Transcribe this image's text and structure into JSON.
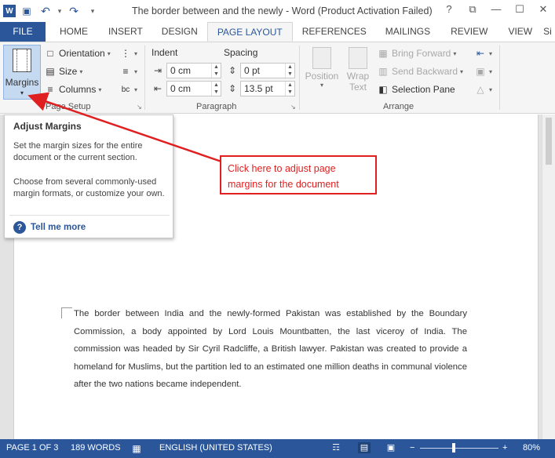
{
  "window": {
    "title": "The border between and the newly - Word (Product Activation Failed)",
    "controls": {
      "help": "?",
      "ribbon_display": "⧉",
      "minimize": "—",
      "maximize": "☐",
      "close": "✕"
    }
  },
  "qat": {
    "logo": "W",
    "save_icon": "💾",
    "undo_icon": "↶",
    "undo_caret": "▾",
    "redo_icon": "↷",
    "customize_icon": "▾"
  },
  "tabs": [
    "FILE",
    "HOME",
    "INSERT",
    "DESIGN",
    "PAGE LAYOUT",
    "REFERENCES",
    "MAILINGS",
    "REVIEW",
    "VIEW",
    "Si"
  ],
  "ribbon": {
    "page_setup": {
      "label": "Page Setup",
      "margins": "Margins",
      "orientation": "Orientation",
      "size": "Size",
      "columns": "Columns",
      "breaks_icon": "⋮",
      "line_numbers_icon": "≡",
      "hyphenation_icon": "bc"
    },
    "paragraph": {
      "label": "Paragraph",
      "indent_header": "Indent",
      "spacing_header": "Spacing",
      "indent_left": "0 cm",
      "indent_right": "0 cm",
      "spacing_before": "0 pt",
      "spacing_after": "13.5 pt"
    },
    "arrange": {
      "label": "Arrange",
      "position": "Position",
      "wrap_text_1": "Wrap",
      "wrap_text_2": "Text",
      "bring_forward": "Bring Forward",
      "send_backward": "Send Backward",
      "selection_pane": "Selection Pane"
    }
  },
  "tooltip": {
    "title": "Adjust Margins",
    "para1": "Set the margin sizes for the entire document or the current section.",
    "para2": "Choose from several commonly-used margin formats, or customize your own.",
    "help_link": "Tell me more"
  },
  "callout": {
    "text": "Click here to adjust page margins for the document",
    "color": "#e02020"
  },
  "document": {
    "body": "The border between India and the newly-formed Pakistan was established by the Boundary Commission, a body appointed by Lord Louis Mountbatten, the last viceroy of India. The commission was headed by Sir Cyril Radcliffe, a British lawyer. Pakistan was created to provide a homeland for Muslims, but the partition led to an estimated one million deaths in communal violence after the two nations became independent."
  },
  "status": {
    "page": "PAGE 1 OF 3",
    "words": "189 WORDS",
    "language": "ENGLISH (UNITED STATES)",
    "zoom": "80%",
    "zoom_out": "−",
    "zoom_in": "+"
  },
  "colors": {
    "accent": "#2b579a",
    "status_bar": "#2b579a"
  }
}
